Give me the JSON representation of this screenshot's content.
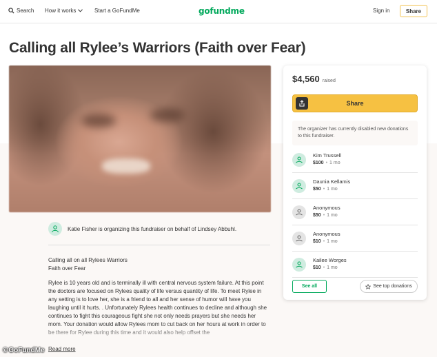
{
  "header": {
    "search_label": "Search",
    "how_it_works_label": "How it works",
    "start_label": "Start a GoFundMe",
    "logo_text": "gofundme",
    "signin_label": "Sign in",
    "share_label": "Share"
  },
  "campaign": {
    "title": "Calling all Rylee’s Warriors (Faith over Fear)",
    "organizer_text": "Katie Fisher is organizing this fundraiser on behalf of Lindsey Abbuhl.",
    "story": [
      "Calling all on all Rylees Warriors",
      "Faith over Fear",
      "Rylee is 10 years old and is terminally ill with central nervous system failure. At this point the doctors are focused on Rylees quality of life versus quantity of life. To meet Rylee in any setting is to love her, she is a friend to all and her sense of humor will have you laughing until it hurts. . Unfortunately Rylees health continues to decline and although she continues to fight this courageous fight she not only needs prayers but she needs her mom. Your donation would allow Rylees mom to cut back on her hours at work in order to be there for Rylee during this time and it would also help offset the"
    ],
    "read_more_label": "Read more"
  },
  "donation_card": {
    "amount": "$4,560",
    "amount_label": "raised",
    "share_label": "Share",
    "notice": "The organizer has currently disabled new donations to this fundraiser.",
    "donors": [
      {
        "name": "Kim Trussell",
        "amount": "$100",
        "time": "1 mo",
        "avatar": "green"
      },
      {
        "name": "Daunia Kellamis",
        "amount": "$50",
        "time": "1 mo",
        "avatar": "green"
      },
      {
        "name": "Anonymous",
        "amount": "$50",
        "time": "1 mo",
        "avatar": "gray"
      },
      {
        "name": "Anonymous",
        "amount": "$10",
        "time": "1 mo",
        "avatar": "gray"
      },
      {
        "name": "Kailee Worges",
        "amount": "$10",
        "time": "1 mo",
        "avatar": "green"
      }
    ],
    "see_all_label": "See all",
    "see_top_label": "See top donations"
  },
  "watermark": "GoFundMe",
  "colors": {
    "brand_green": "#02a95c",
    "share_yellow": "#f6c142",
    "beige": "#fbf8f6"
  }
}
